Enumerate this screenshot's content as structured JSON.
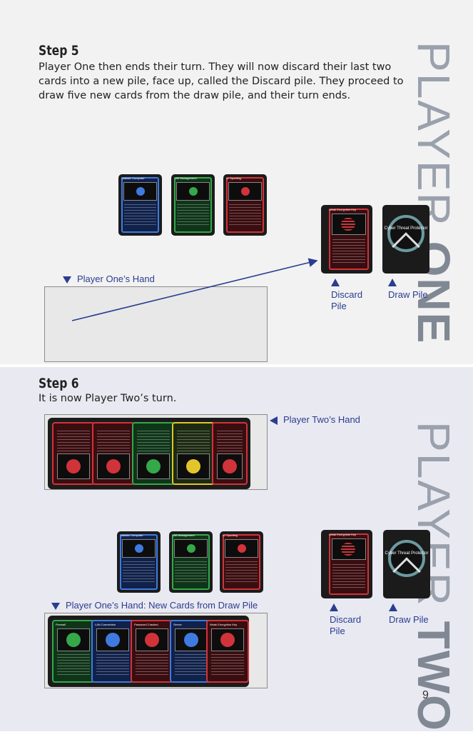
{
  "step5": {
    "heading": "Step 5",
    "body": "Player One then ends their turn. They will now discard their last two cards into a new pile, face up, called the Discard pile. They proceed to draw five new cards from the draw pile, and their turn ends.",
    "side_light": "PLAYER ",
    "side_bold": "ONE",
    "played_cards": [
      {
        "title": "Statistic Computer",
        "color": "blue"
      },
      {
        "title": "SIM Management",
        "color": "green"
      },
      {
        "title": "ID Spoofing",
        "color": "red"
      }
    ],
    "discard_card_title": "Weak Encryption Key",
    "draw_card_label": "Cyber Threat Protector",
    "hand_label": "Player One’s Hand",
    "discard_label": "Discard Pile",
    "draw_label": "Draw Pile"
  },
  "step6": {
    "heading": "Step 6",
    "body": "It is now Player Two’s turn.",
    "side_light": "PLAYER ",
    "side_bold": "TWO",
    "p2_hand_label": "Player Two’s Hand",
    "p2_hand_cards": [
      {
        "title": "",
        "color": "red"
      },
      {
        "title": "",
        "color": "red"
      },
      {
        "title": "",
        "color": "green"
      },
      {
        "title": "",
        "color": "yellow"
      },
      {
        "title": "",
        "color": "red"
      }
    ],
    "played_cards": [
      {
        "title": "Statistic Computer",
        "color": "blue"
      },
      {
        "title": "SIM Management",
        "color": "green"
      },
      {
        "title": "ID Spoofing",
        "color": "red"
      }
    ],
    "discard_card_title": "Weak Encryption Key",
    "draw_card_label": "Cyber Threat Protector",
    "discard_label": "Discard Pile",
    "draw_label": "Draw Pile",
    "p1_new_label": "Player One’s Hand: New Cards from Draw Pile",
    "p1_new_cards": [
      {
        "title": "Firewall",
        "color": "green"
      },
      {
        "title": "LAN Connection",
        "color": "blue"
      },
      {
        "title": "Password Cracked",
        "color": "red"
      },
      {
        "title": "Server",
        "color": "blue"
      },
      {
        "title": "Weak Encryption Key",
        "color": "red"
      }
    ]
  },
  "page_number": "9"
}
